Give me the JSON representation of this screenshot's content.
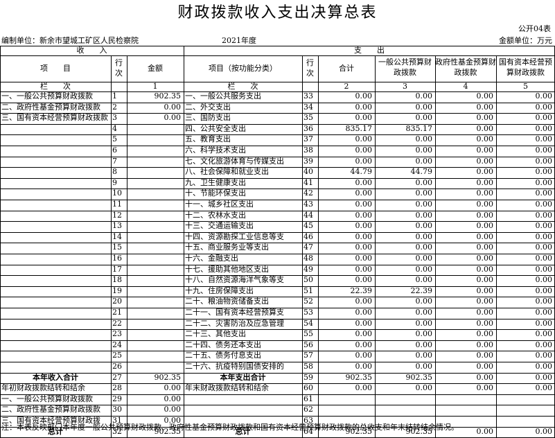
{
  "title": "财政拨款收入支出决算总表",
  "form_no": "公开04表",
  "org": "编制单位：新余市望城工矿区人民检察院",
  "year": "2021年度",
  "unit": "金额单位：万元",
  "section": {
    "income": "收　　入",
    "expense": "支　　出"
  },
  "head": {
    "item": "项　　目",
    "row": "行次",
    "amount": "金额",
    "exp_item": "项目（按功能分类）",
    "total": "合计",
    "gpb": "一般公共预算财政拨款",
    "gov_fund": "政府性基金预算财政拨款",
    "soe": "国有资本经营预算财政拨款"
  },
  "colrow": {
    "label": "栏　　次",
    "c1": "1",
    "exp_label": "栏　　次",
    "c2": "2",
    "c3": "3",
    "c4": "4",
    "c5": "5"
  },
  "rows": [
    {
      "in": "一、一般公共预算财政拨款",
      "ln": "1",
      "amt": "902.35",
      "ex": "一、一般公共服务支出",
      "eln": "33",
      "t": "0.00",
      "g": "0.00",
      "f": "0.00",
      "s": "0.00"
    },
    {
      "in": "二、政府性基金预算财政拨款",
      "ln": "2",
      "amt": "0.00",
      "ex": "二、外交支出",
      "eln": "34",
      "t": "0.00",
      "g": "0.00",
      "f": "0.00",
      "s": "0.00"
    },
    {
      "in": "三、国有资本经营预算财政拨款",
      "ln": "3",
      "amt": "0.00",
      "ex": "三、国防支出",
      "eln": "35",
      "t": "0.00",
      "g": "0.00",
      "f": "0.00",
      "s": "0.00"
    },
    {
      "in": "",
      "ln": "4",
      "amt": "",
      "ex": "四、公共安全支出",
      "eln": "36",
      "t": "835.17",
      "g": "835.17",
      "f": "0.00",
      "s": "0.00"
    },
    {
      "in": "",
      "ln": "5",
      "amt": "",
      "ex": "五、教育支出",
      "eln": "37",
      "t": "0.00",
      "g": "0.00",
      "f": "0.00",
      "s": "0.00"
    },
    {
      "in": "",
      "ln": "6",
      "amt": "",
      "ex": "六、科学技术支出",
      "eln": "38",
      "t": "0.00",
      "g": "0.00",
      "f": "0.00",
      "s": "0.00"
    },
    {
      "in": "",
      "ln": "7",
      "amt": "",
      "ex": "七、文化旅游体育与传媒支出",
      "eln": "39",
      "t": "0.00",
      "g": "0.00",
      "f": "0.00",
      "s": "0.00"
    },
    {
      "in": "",
      "ln": "8",
      "amt": "",
      "ex": "八、社会保障和就业支出",
      "eln": "40",
      "t": "44.79",
      "g": "44.79",
      "f": "0.00",
      "s": "0.00"
    },
    {
      "in": "",
      "ln": "9",
      "amt": "",
      "ex": "九、卫生健康支出",
      "eln": "41",
      "t": "0.00",
      "g": "0.00",
      "f": "0.00",
      "s": "0.00"
    },
    {
      "in": "",
      "ln": "10",
      "amt": "",
      "ex": "十、节能环保支出",
      "eln": "42",
      "t": "0.00",
      "g": "0.00",
      "f": "0.00",
      "s": "0.00"
    },
    {
      "in": "",
      "ln": "11",
      "amt": "",
      "ex": "十一、城乡社区支出",
      "eln": "43",
      "t": "0.00",
      "g": "0.00",
      "f": "0.00",
      "s": "0.00"
    },
    {
      "in": "",
      "ln": "12",
      "amt": "",
      "ex": "十二、农林水支出",
      "eln": "44",
      "t": "0.00",
      "g": "0.00",
      "f": "0.00",
      "s": "0.00"
    },
    {
      "in": "",
      "ln": "13",
      "amt": "",
      "ex": "十三、交通运输支出",
      "eln": "45",
      "t": "0.00",
      "g": "0.00",
      "f": "0.00",
      "s": "0.00"
    },
    {
      "in": "",
      "ln": "14",
      "amt": "",
      "ex": "十四、资源勘探工业信息等支",
      "eln": "46",
      "t": "0.00",
      "g": "0.00",
      "f": "0.00",
      "s": "0.00"
    },
    {
      "in": "",
      "ln": "15",
      "amt": "",
      "ex": "十五、商业服务业等支出",
      "eln": "47",
      "t": "0.00",
      "g": "0.00",
      "f": "0.00",
      "s": "0.00"
    },
    {
      "in": "",
      "ln": "16",
      "amt": "",
      "ex": "十六、金融支出",
      "eln": "48",
      "t": "0.00",
      "g": "0.00",
      "f": "0.00",
      "s": "0.00"
    },
    {
      "in": "",
      "ln": "17",
      "amt": "",
      "ex": "十七、援助其他地区支出",
      "eln": "49",
      "t": "0.00",
      "g": "0.00",
      "f": "0.00",
      "s": "0.00"
    },
    {
      "in": "",
      "ln": "18",
      "amt": "",
      "ex": "十八、自然资源海洋气象等支",
      "eln": "50",
      "t": "0.00",
      "g": "0.00",
      "f": "0.00",
      "s": "0.00"
    },
    {
      "in": "",
      "ln": "19",
      "amt": "",
      "ex": "十九、住房保障支出",
      "eln": "51",
      "t": "22.39",
      "g": "22.39",
      "f": "0.00",
      "s": "0.00"
    },
    {
      "in": "",
      "ln": "20",
      "amt": "",
      "ex": "二十、粮油物资储备支出",
      "eln": "52",
      "t": "0.00",
      "g": "0.00",
      "f": "0.00",
      "s": "0.00"
    },
    {
      "in": "",
      "ln": "21",
      "amt": "",
      "ex": "二十一、国有资本经营预算支",
      "eln": "53",
      "t": "0.00",
      "g": "0.00",
      "f": "0.00",
      "s": "0.00"
    },
    {
      "in": "",
      "ln": "22",
      "amt": "",
      "ex": "二十二、灾害防治及应急管理",
      "eln": "54",
      "t": "0.00",
      "g": "0.00",
      "f": "0.00",
      "s": "0.00"
    },
    {
      "in": "",
      "ln": "23",
      "amt": "",
      "ex": "二十三、其他支出",
      "eln": "55",
      "t": "0.00",
      "g": "0.00",
      "f": "0.00",
      "s": "0.00"
    },
    {
      "in": "",
      "ln": "24",
      "amt": "",
      "ex": "二十四、债务还本支出",
      "eln": "56",
      "t": "0.00",
      "g": "0.00",
      "f": "0.00",
      "s": "0.00"
    },
    {
      "in": "",
      "ln": "25",
      "amt": "",
      "ex": "二十五、债务付息支出",
      "eln": "57",
      "t": "0.00",
      "g": "0.00",
      "f": "0.00",
      "s": "0.00"
    },
    {
      "in": "",
      "ln": "26",
      "amt": "",
      "ex": "二十六、抗疫特别国债安排的",
      "eln": "58",
      "t": "0.00",
      "g": "0.00",
      "f": "0.00",
      "s": "0.00"
    },
    {
      "in": "本年收入合计",
      "ln": "27",
      "amt": "902.35",
      "ex": "本年支出合计",
      "eln": "59",
      "t": "902.35",
      "g": "902.35",
      "f": "0.00",
      "s": "0.00",
      "bold": true
    },
    {
      "in": "年初财政拨款结转和结余",
      "ln": "28",
      "amt": "0.00",
      "ex": "年末财政拨款结转和结余",
      "eln": "60",
      "t": "0.00",
      "g": "0.00",
      "f": "0.00",
      "s": "0.00"
    },
    {
      "in": "一、一般公共预算财政拨款",
      "ln": "29",
      "amt": "0.00",
      "ex": "",
      "eln": "61",
      "t": "",
      "g": "",
      "f": "",
      "s": ""
    },
    {
      "in": "二、政府性基金预算财政拨款",
      "ln": "30",
      "amt": "0.00",
      "ex": "",
      "eln": "62",
      "t": "",
      "g": "",
      "f": "",
      "s": ""
    },
    {
      "in": "三、国有资本经营预算财政拨",
      "ln": "31",
      "amt": "0.00",
      "ex": "",
      "eln": "63",
      "t": "",
      "g": "",
      "f": "",
      "s": ""
    },
    {
      "in": "总计",
      "ln": "32",
      "amt": "902.35",
      "ex": "总计",
      "eln": "64",
      "t": "902.35",
      "g": "902.35",
      "f": "0.00",
      "s": "0.00",
      "bold": true
    }
  ],
  "note": "注：本表反映部门本年度一般公共预算财政拨款、政府性基金预算财政拨款和国有资本经营预算财政拨款的总收支和年末结转结余情况。"
}
